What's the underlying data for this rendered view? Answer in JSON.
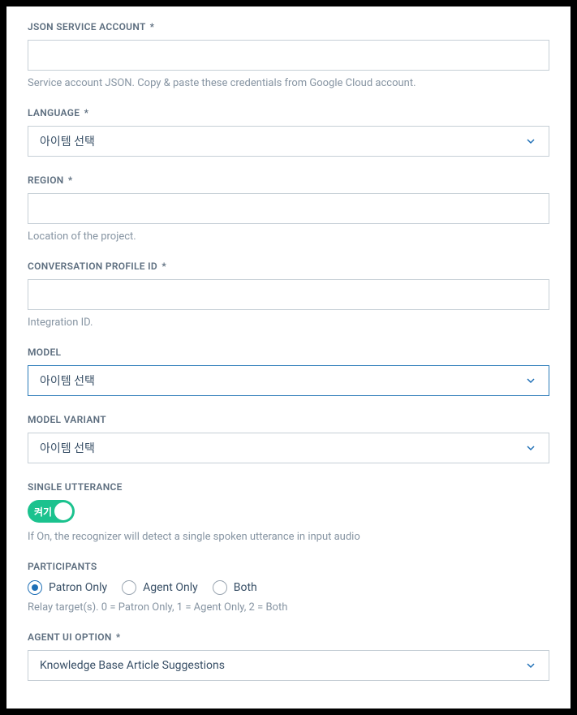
{
  "jsonAccount": {
    "label": "JSON SERVICE ACCOUNT",
    "required": "*",
    "value": "",
    "helper": "Service account JSON. Copy & paste these credentials from Google Cloud account."
  },
  "language": {
    "label": "LANGUAGE",
    "required": "*",
    "selected": "아이템 선택"
  },
  "region": {
    "label": "REGION",
    "required": "*",
    "value": "",
    "helper": "Location of the project."
  },
  "convProfile": {
    "label": "CONVERSATION PROFILE ID",
    "required": "*",
    "value": "",
    "helper": "Integration ID."
  },
  "model": {
    "label": "MODEL",
    "selected": "아이템 선택"
  },
  "modelVariant": {
    "label": "MODEL VARIANT",
    "selected": "아이템 선택"
  },
  "singleUtterance": {
    "label": "SINGLE UTTERANCE",
    "toggle": "켜기",
    "helper": "If On, the recognizer will detect a single spoken utterance in input audio"
  },
  "participants": {
    "label": "PARTICIPANTS",
    "options": {
      "0": "Patron Only",
      "1": "Agent Only",
      "2": "Both"
    },
    "helper": "Relay target(s). 0 = Patron Only, 1 = Agent Only, 2 = Both"
  },
  "agentUi": {
    "label": "AGENT UI OPTION",
    "required": "*",
    "selected": "Knowledge Base Article Suggestions"
  }
}
